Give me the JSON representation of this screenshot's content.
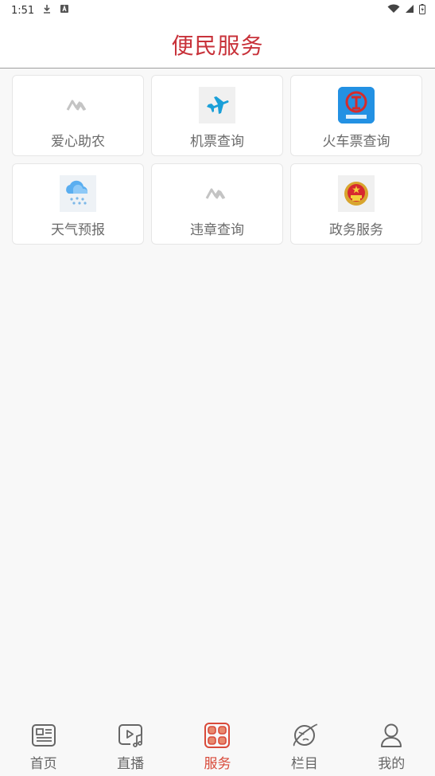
{
  "status_bar": {
    "time": "1:51"
  },
  "header": {
    "title": "便民服务"
  },
  "services": [
    {
      "label": "爱心助农",
      "icon": "placeholder-logo-icon"
    },
    {
      "label": "机票查询",
      "icon": "airplane-icon"
    },
    {
      "label": "火车票查询",
      "icon": "china-railway-icon"
    },
    {
      "label": "天气预报",
      "icon": "weather-snow-icon"
    },
    {
      "label": "违章查询",
      "icon": "placeholder-logo-icon"
    },
    {
      "label": "政务服务",
      "icon": "national-emblem-icon"
    }
  ],
  "tabs": [
    {
      "label": "首页",
      "icon": "news-icon",
      "active": false
    },
    {
      "label": "直播",
      "icon": "video-music-icon",
      "active": false
    },
    {
      "label": "服务",
      "icon": "grid-icon",
      "active": true
    },
    {
      "label": "栏目",
      "icon": "planet-icon",
      "active": false
    },
    {
      "label": "我的",
      "icon": "user-icon",
      "active": false
    }
  ],
  "colors": {
    "accent": "#c8323a",
    "tab_active": "#d84a3a"
  }
}
